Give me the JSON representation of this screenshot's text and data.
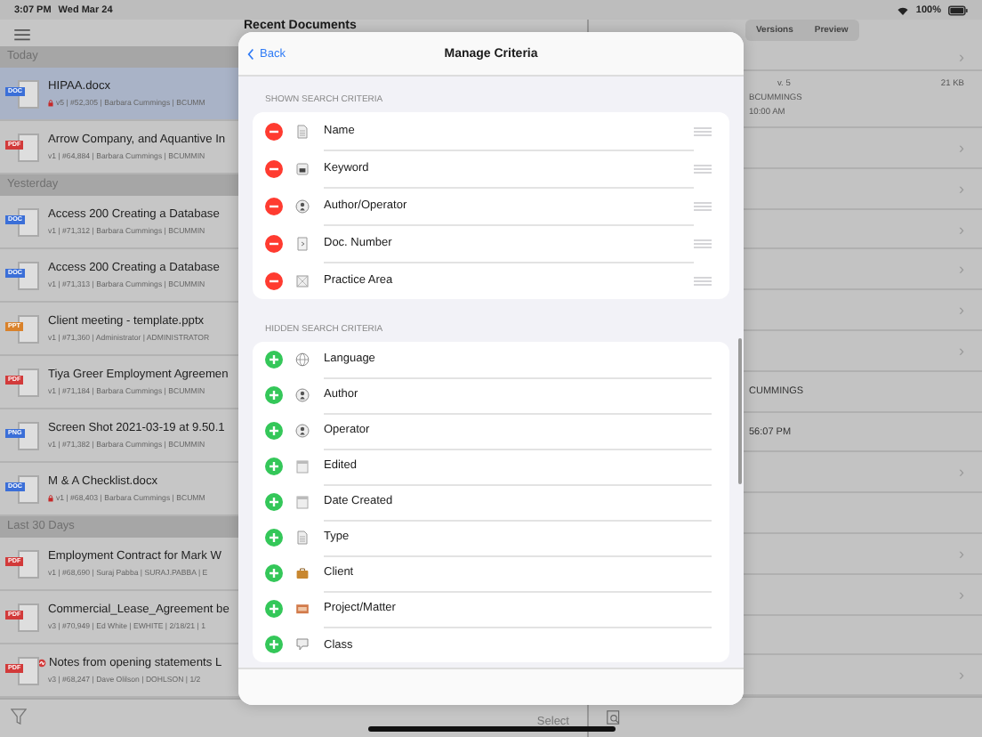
{
  "status_bar": {
    "time": "3:07 PM",
    "date": "Wed Mar 24",
    "battery": "100%"
  },
  "left_pane": {
    "title": "Recent Documents",
    "sections": [
      {
        "header": "Today",
        "documents": [
          {
            "type": "DOC",
            "color": "#3b6fd8",
            "name": "HIPAA.docx",
            "meta": "v5 | #52,305 | Barbara Cummings | BCUMM",
            "kind": "locked",
            "selected": true
          },
          {
            "type": "PDF",
            "color": "#d23a3a",
            "name": "Arrow Company, and Aquantive In",
            "meta": "v1 | #64,884 | Barbara Cummings | BCUMMIN",
            "selected": false
          }
        ]
      },
      {
        "header": "Yesterday",
        "documents": [
          {
            "type": "DOC",
            "color": "#3b6fd8",
            "name": "Access 200 Creating a Database",
            "meta": "v1 | #71,312 | Barbara Cummings | BCUMMIN",
            "selected": false
          },
          {
            "type": "DOC",
            "color": "#3b6fd8",
            "name": "Access 200 Creating a Database",
            "meta": "v1 | #71,313 | Barbara Cummings | BCUMMIN",
            "selected": false
          },
          {
            "type": "PPT",
            "color": "#d9822b",
            "name": "Client meeting - template.pptx",
            "meta": "v1 | #71,360 | Administrator | ADMINISTRATOR",
            "selected": false
          },
          {
            "type": "PDF",
            "color": "#d23a3a",
            "name": "Tiya Greer Employment Agreemen",
            "meta": "v1 | #71,184 | Barbara Cummings | BCUMMIN",
            "selected": false
          },
          {
            "type": "PNG",
            "color": "#3b6fd8",
            "name": "Screen Shot 2021-03-19 at 9.50.1",
            "meta": "v1 | #71,382 | Barbara Cummings | BCUMMIN",
            "selected": false
          },
          {
            "type": "DOC",
            "color": "#3b6fd8",
            "name": "M & A Checklist.docx",
            "meta": "v1 | #68,403 | Barbara Cummings | BCUMM",
            "kind": "locked",
            "selected": false
          }
        ]
      },
      {
        "header": "Last 30 Days",
        "documents": [
          {
            "type": "PDF",
            "color": "#d23a3a",
            "name": "Employment Contract for Mark W",
            "meta": "v1 | #68,690 | Suraj Pabba | SURAJ.PABBA | E",
            "selected": false
          },
          {
            "type": "PDF",
            "color": "#d23a3a",
            "name": "Commercial_Lease_Agreement be",
            "meta": "v3 | #70,949 | Ed White | EWHITE | 2/18/21 | 1",
            "selected": false
          },
          {
            "type": "PDF",
            "color": "#d23a3a",
            "name": "Notes from opening statements L",
            "meta": "v3 | #68,247 | Dave Olilson | DOHLSON | 1/2",
            "kind": "signed",
            "selected": false
          }
        ]
      }
    ],
    "select_button": "Select"
  },
  "right_pane": {
    "tabs": [
      {
        "label": "Versions",
        "selected": false
      },
      {
        "label": "Preview",
        "selected": false
      }
    ],
    "info": {
      "version": "v. 5",
      "size": "21 KB",
      "author": "BCUMMINGS",
      "time": "10:00 AM"
    },
    "top_row": {
      "chevron": "›"
    },
    "rows": [
      {
        "chevron": "›"
      },
      {
        "chevron": "›"
      },
      {
        "chevron": "›"
      },
      {
        "chevron": "›"
      },
      {
        "chevron": "›"
      },
      {
        "chevron": "›"
      },
      {
        "text": "CUMMINGS"
      },
      {
        "text": "56:07 PM"
      },
      {
        "chevron": "›"
      },
      {},
      {
        "chevron": "›"
      },
      {
        "chevron": "›"
      },
      {},
      {
        "chevron": "›"
      }
    ]
  },
  "modal": {
    "back": "Back",
    "title": "Manage Criteria",
    "sections": [
      {
        "label": "SHOWN SEARCH CRITERIA",
        "kind": "removable",
        "reorderable": true,
        "items": [
          {
            "label": "Name",
            "kind": "document"
          },
          {
            "label": "Keyword",
            "kind": "keyword"
          },
          {
            "label": "Author/Operator",
            "kind": "person"
          },
          {
            "label": "Doc. Number",
            "kind": "number"
          },
          {
            "label": "Practice Area",
            "kind": "area"
          }
        ]
      },
      {
        "label": "HIDDEN SEARCH CRITERIA",
        "kind": "addable",
        "reorderable": false,
        "items": [
          {
            "label": "Language",
            "kind": "globe"
          },
          {
            "label": "Author",
            "kind": "person"
          },
          {
            "label": "Operator",
            "kind": "person"
          },
          {
            "label": "Edited",
            "kind": "calendar"
          },
          {
            "label": "Date Created",
            "kind": "calendar"
          },
          {
            "label": "Type",
            "kind": "document"
          },
          {
            "label": "Client",
            "kind": "briefcase"
          },
          {
            "label": "Project/Matter",
            "kind": "folder"
          },
          {
            "label": "Class",
            "kind": "class"
          }
        ]
      }
    ]
  }
}
